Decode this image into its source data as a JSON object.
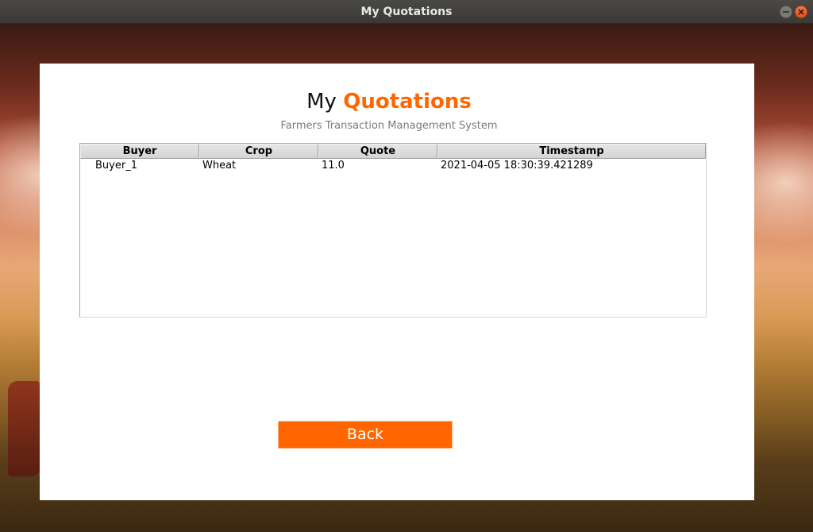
{
  "window": {
    "title": "My Quotations"
  },
  "heading": {
    "part1": "My",
    "part2": "Quotations"
  },
  "subtitle": "Farmers Transaction Management System",
  "table": {
    "columns": [
      "Buyer",
      "Crop",
      "Quote",
      "Timestamp"
    ],
    "rows": [
      [
        "Buyer_1",
        "Wheat",
        "11.0",
        "2021-04-05 18:30:39.421289"
      ]
    ]
  },
  "back_button": {
    "label": "Back"
  },
  "colors": {
    "accent": "#ff6600",
    "subtitle": "#7a7a7a",
    "titlebar": "#3c3b37",
    "close_button": "#e95420"
  }
}
